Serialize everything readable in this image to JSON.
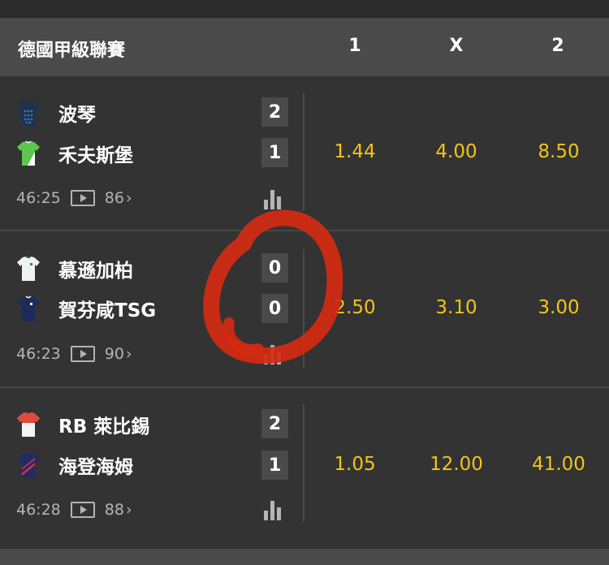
{
  "header": {
    "league": "德國甲級聯賽",
    "col1": "1",
    "colx": "X",
    "col2": "2"
  },
  "matches": [
    {
      "home": "波琴",
      "away": "禾夫斯堡",
      "home_score": "2",
      "away_score": "1",
      "odd1": "1.44",
      "oddx": "4.00",
      "odd2": "8.50",
      "time": "46:25",
      "markets": "86",
      "chevron": "›"
    },
    {
      "home": "慕遜加柏",
      "away": "賀芬咸TSG",
      "home_score": "0",
      "away_score": "0",
      "odd1": "2.50",
      "oddx": "3.10",
      "odd2": "3.00",
      "time": "46:23",
      "markets": "90",
      "chevron": "›"
    },
    {
      "home": "RB 萊比錫",
      "away": "海登海姆",
      "home_score": "2",
      "away_score": "1",
      "odd1": "1.05",
      "oddx": "12.00",
      "odd2": "41.00",
      "time": "46:28",
      "markets": "88",
      "chevron": "›"
    }
  ],
  "icons": {
    "jerseys": [
      "navy-dotted-jersey-icon",
      "green-white-jersey-icon",
      "white-jersey-icon",
      "navy-jersey-icon",
      "white-red-jersey-icon",
      "navy-red-jersey-icon"
    ],
    "video": "tv-play-icon",
    "stats": "bar-chart-icon"
  },
  "colors": {
    "odds": "#f2c41a",
    "annotation": "#d42a10"
  }
}
